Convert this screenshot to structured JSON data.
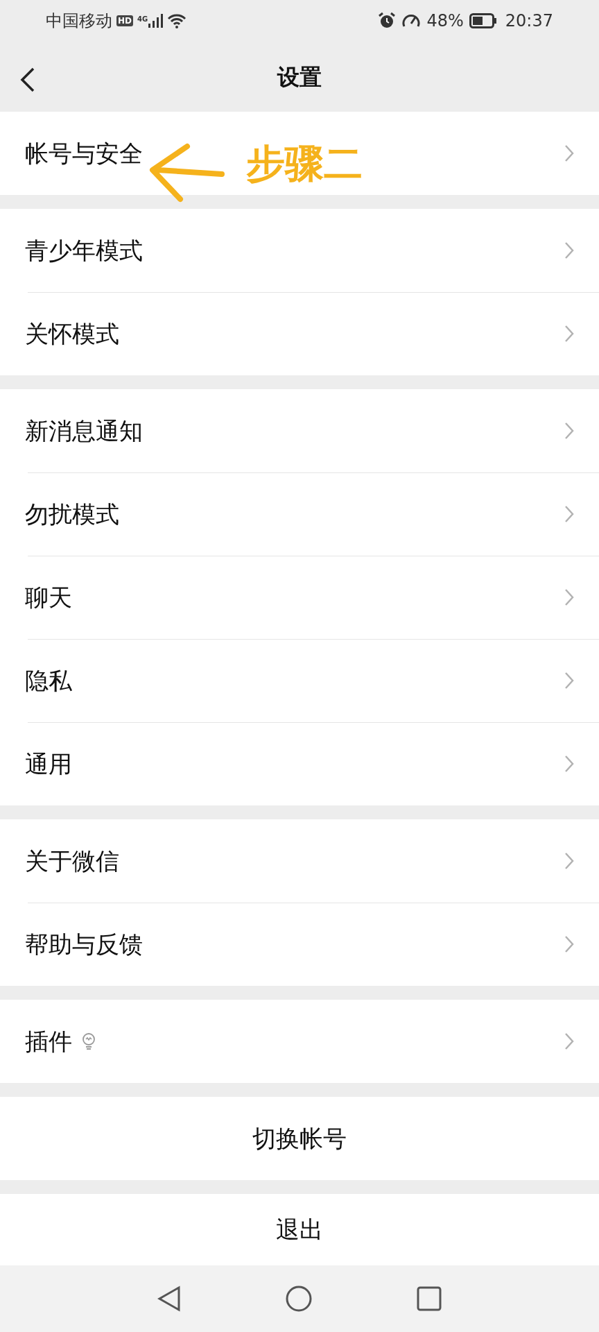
{
  "status_bar": {
    "carrier": "中国移动",
    "hd": "HD",
    "network": "4G",
    "battery_text": "48%",
    "time": "20:37"
  },
  "header": {
    "title": "设置"
  },
  "sections": [
    {
      "items": [
        {
          "kind": "row",
          "label": "帐号与安全"
        }
      ]
    },
    {
      "items": [
        {
          "kind": "row",
          "label": "青少年模式"
        },
        {
          "kind": "row",
          "label": "关怀模式"
        }
      ]
    },
    {
      "items": [
        {
          "kind": "row",
          "label": "新消息通知"
        },
        {
          "kind": "row",
          "label": "勿扰模式"
        },
        {
          "kind": "row",
          "label": "聊天"
        },
        {
          "kind": "row",
          "label": "隐私"
        },
        {
          "kind": "row",
          "label": "通用"
        }
      ]
    },
    {
      "items": [
        {
          "kind": "row",
          "label": "关于微信"
        },
        {
          "kind": "row",
          "label": "帮助与反馈"
        }
      ]
    },
    {
      "items": [
        {
          "kind": "row-bulb",
          "label": "插件"
        }
      ]
    },
    {
      "items": [
        {
          "kind": "action",
          "label": "切换帐号"
        }
      ]
    },
    {
      "items": [
        {
          "kind": "action",
          "label": "退出"
        }
      ]
    }
  ],
  "annotation": {
    "text": "步骤二"
  }
}
